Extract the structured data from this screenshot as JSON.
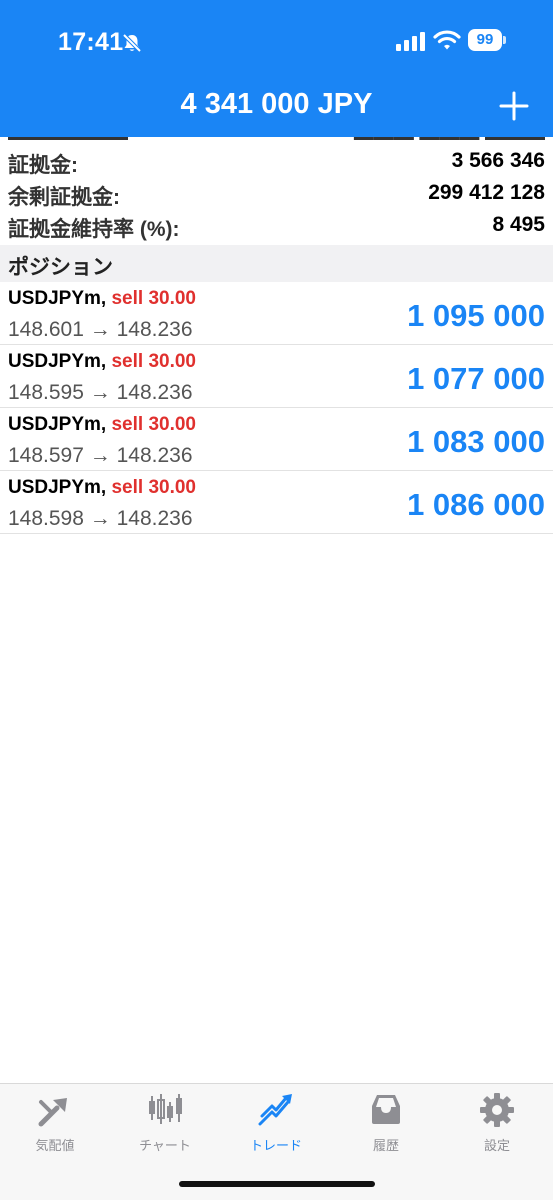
{
  "status_bar": {
    "time": "17:41",
    "battery": "99"
  },
  "header": {
    "title": "4 341 000 JPY",
    "add_label": "+"
  },
  "account": [
    {
      "label": "証拠金:",
      "value": "3 566 346"
    },
    {
      "label": "余剰証拠金:",
      "value": "299 412 128"
    },
    {
      "label": "証拠金維持率 (%):",
      "value": "8 495"
    }
  ],
  "positions_header": "ポジション",
  "positions": [
    {
      "symbol": "USDJPYm,",
      "type": "sell 30.00",
      "open_price": "148.601",
      "arrow": "→",
      "current_price": "148.236",
      "profit": "1 095 000"
    },
    {
      "symbol": "USDJPYm,",
      "type": "sell 30.00",
      "open_price": "148.595",
      "arrow": "→",
      "current_price": "148.236",
      "profit": "1 077 000"
    },
    {
      "symbol": "USDJPYm,",
      "type": "sell 30.00",
      "open_price": "148.597",
      "arrow": "→",
      "current_price": "148.236",
      "profit": "1 083 000"
    },
    {
      "symbol": "USDJPYm,",
      "type": "sell 30.00",
      "open_price": "148.598",
      "arrow": "→",
      "current_price": "148.236",
      "profit": "1 086 000"
    }
  ],
  "tabbar": [
    {
      "label": "気配値",
      "icon": "quotes-icon"
    },
    {
      "label": "チャート",
      "icon": "chart-icon"
    },
    {
      "label": "トレード",
      "icon": "trade-icon",
      "active": true
    },
    {
      "label": "履歴",
      "icon": "history-icon"
    },
    {
      "label": "設定",
      "icon": "settings-icon"
    }
  ],
  "colors": {
    "accent": "#1a85f5",
    "sell": "#e0302e",
    "inactive_tab": "#8e8e93"
  }
}
